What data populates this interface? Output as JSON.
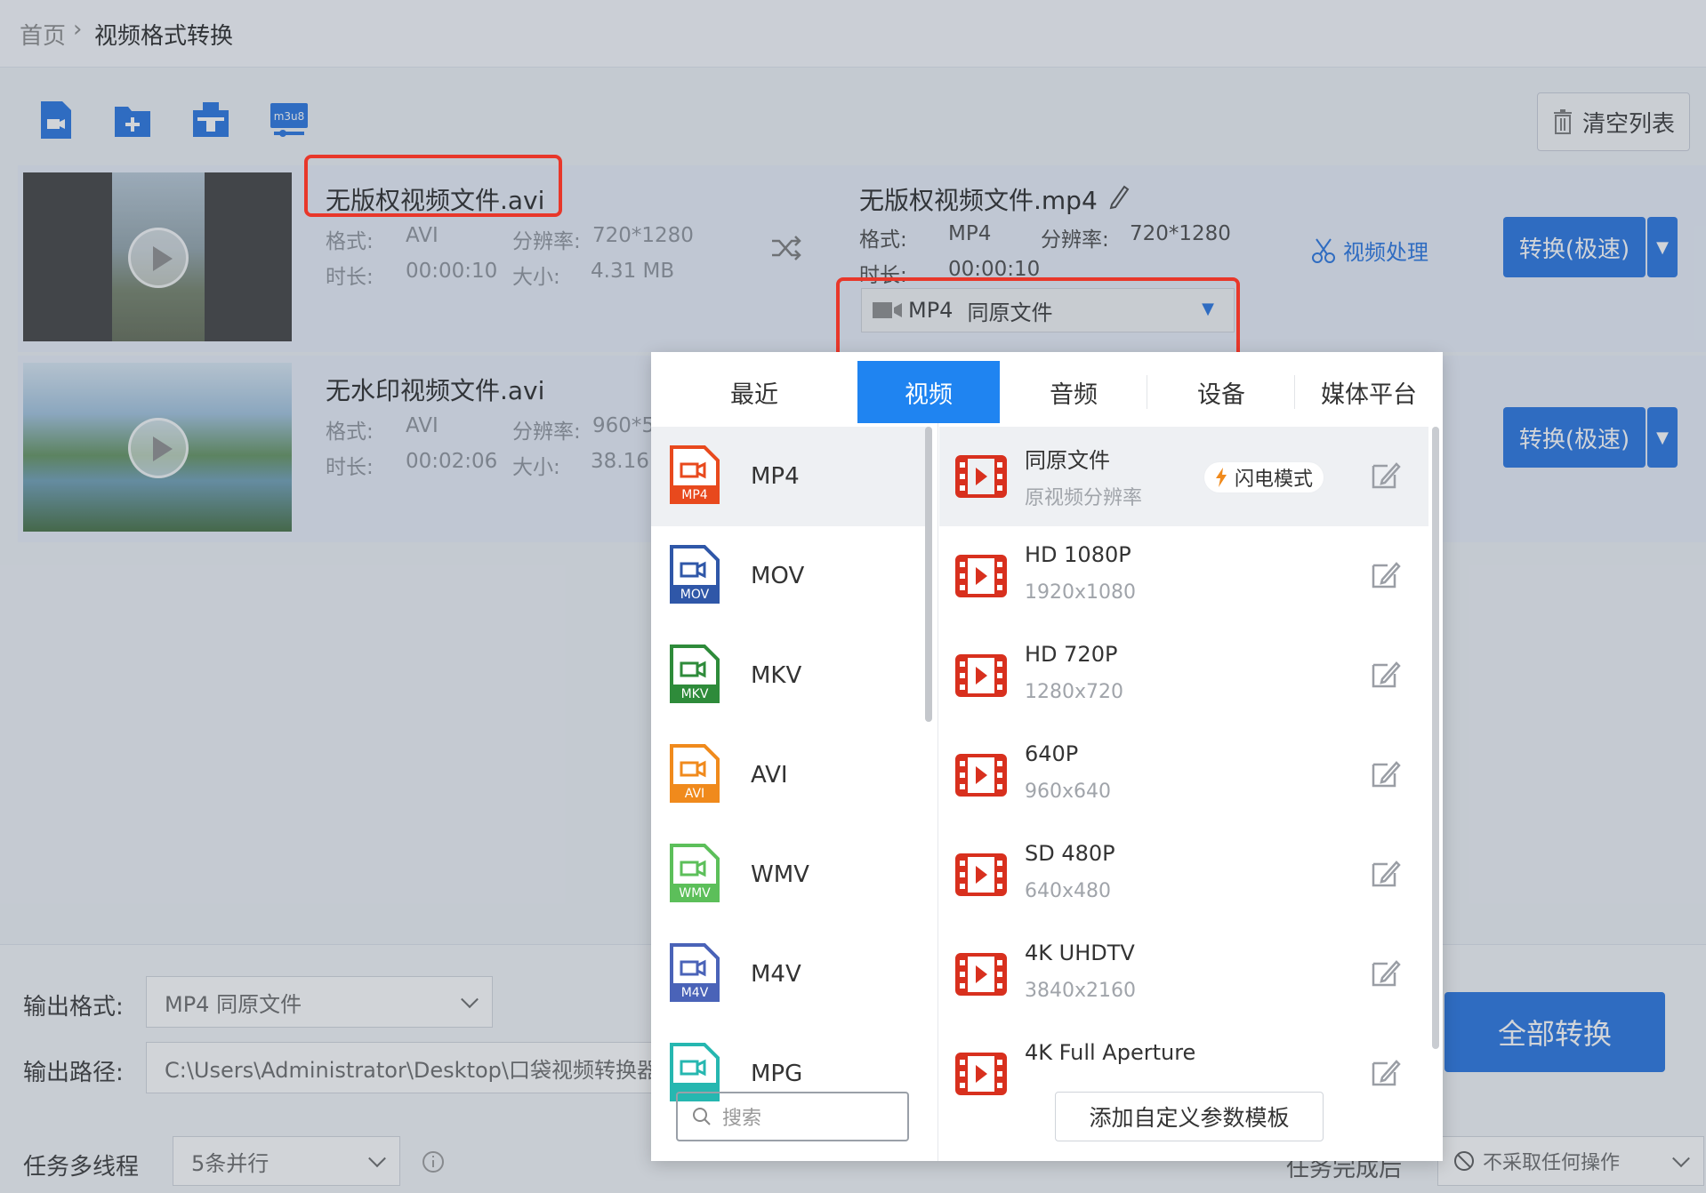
{
  "breadcrumb": {
    "home": "首页",
    "separator": "›",
    "current": "视频格式转换"
  },
  "toolbar": {
    "m3u8_label": "m3u8",
    "clear_list": "清空列表"
  },
  "files": [
    {
      "source_name": "无版权视频文件.avi",
      "format_label": "格式:",
      "format": "AVI",
      "resolution_label": "分辨率:",
      "resolution": "720*1280",
      "duration_label": "时长:",
      "duration": "00:00:10",
      "size_label": "大小:",
      "size": "4.31 MB",
      "output_name": "无版权视频文件.mp4",
      "output_format": "MP4",
      "output_resolution": "720*1280",
      "output_duration": "00:00:10",
      "video_process": "视频处理",
      "convert_label": "转换(极速)",
      "format_select": {
        "format": "MP4",
        "preset": "同原文件"
      }
    },
    {
      "source_name": "无水印视频文件.avi",
      "format_label": "格式:",
      "format": "AVI",
      "resolution_label": "分辨率:",
      "resolution": "960*5",
      "duration_label": "时长:",
      "duration": "00:02:06",
      "size_label": "大小:",
      "size": "38.16",
      "convert_label": "转换(极速)"
    }
  ],
  "dropdown": {
    "tabs": [
      "最近",
      "视频",
      "音频",
      "设备",
      "媒体平台"
    ],
    "active_tab": "视频",
    "categories": [
      {
        "label": "MP4",
        "badge": "MP4",
        "color": "#e8491d"
      },
      {
        "label": "MOV",
        "badge": "MOV",
        "color": "#2f57a8"
      },
      {
        "label": "MKV",
        "badge": "MKV",
        "color": "#2e8b3a"
      },
      {
        "label": "AVI",
        "badge": "AVI",
        "color": "#f08a1c"
      },
      {
        "label": "WMV",
        "badge": "WMV",
        "color": "#5cbf5a"
      },
      {
        "label": "M4V",
        "badge": "M4V",
        "color": "#4a63b8"
      },
      {
        "label": "MPG",
        "badge": "",
        "color": "#26b7b0"
      }
    ],
    "options": [
      {
        "title": "同原文件",
        "sub": "原视频分辨率",
        "badge": "闪电模式"
      },
      {
        "title": "HD 1080P",
        "sub": "1920x1080"
      },
      {
        "title": "HD 720P",
        "sub": "1280x720"
      },
      {
        "title": "640P",
        "sub": "960x640"
      },
      {
        "title": "SD 480P",
        "sub": "640x480"
      },
      {
        "title": "4K UHDTV",
        "sub": "3840x2160"
      },
      {
        "title": "4K Full Aperture",
        "sub": ""
      }
    ],
    "search_placeholder": "搜索",
    "add_template": "添加自定义参数模板"
  },
  "bottom": {
    "output_format_label": "输出格式:",
    "output_format_value": "MP4  同原文件",
    "output_path_label": "输出路径:",
    "output_path_value": "C:\\Users\\Administrator\\Desktop\\口袋视频转换器",
    "threads_label": "任务多线程",
    "threads_value": "5条并行",
    "after_label": "任务完成后",
    "after_value": "不采取任何操作",
    "convert_all": "全部转换"
  },
  "colors": {
    "accent": "#1f6fe0",
    "tab_active": "#1f84f1",
    "highlight": "#e8372a",
    "icon_red": "#d8301e"
  }
}
